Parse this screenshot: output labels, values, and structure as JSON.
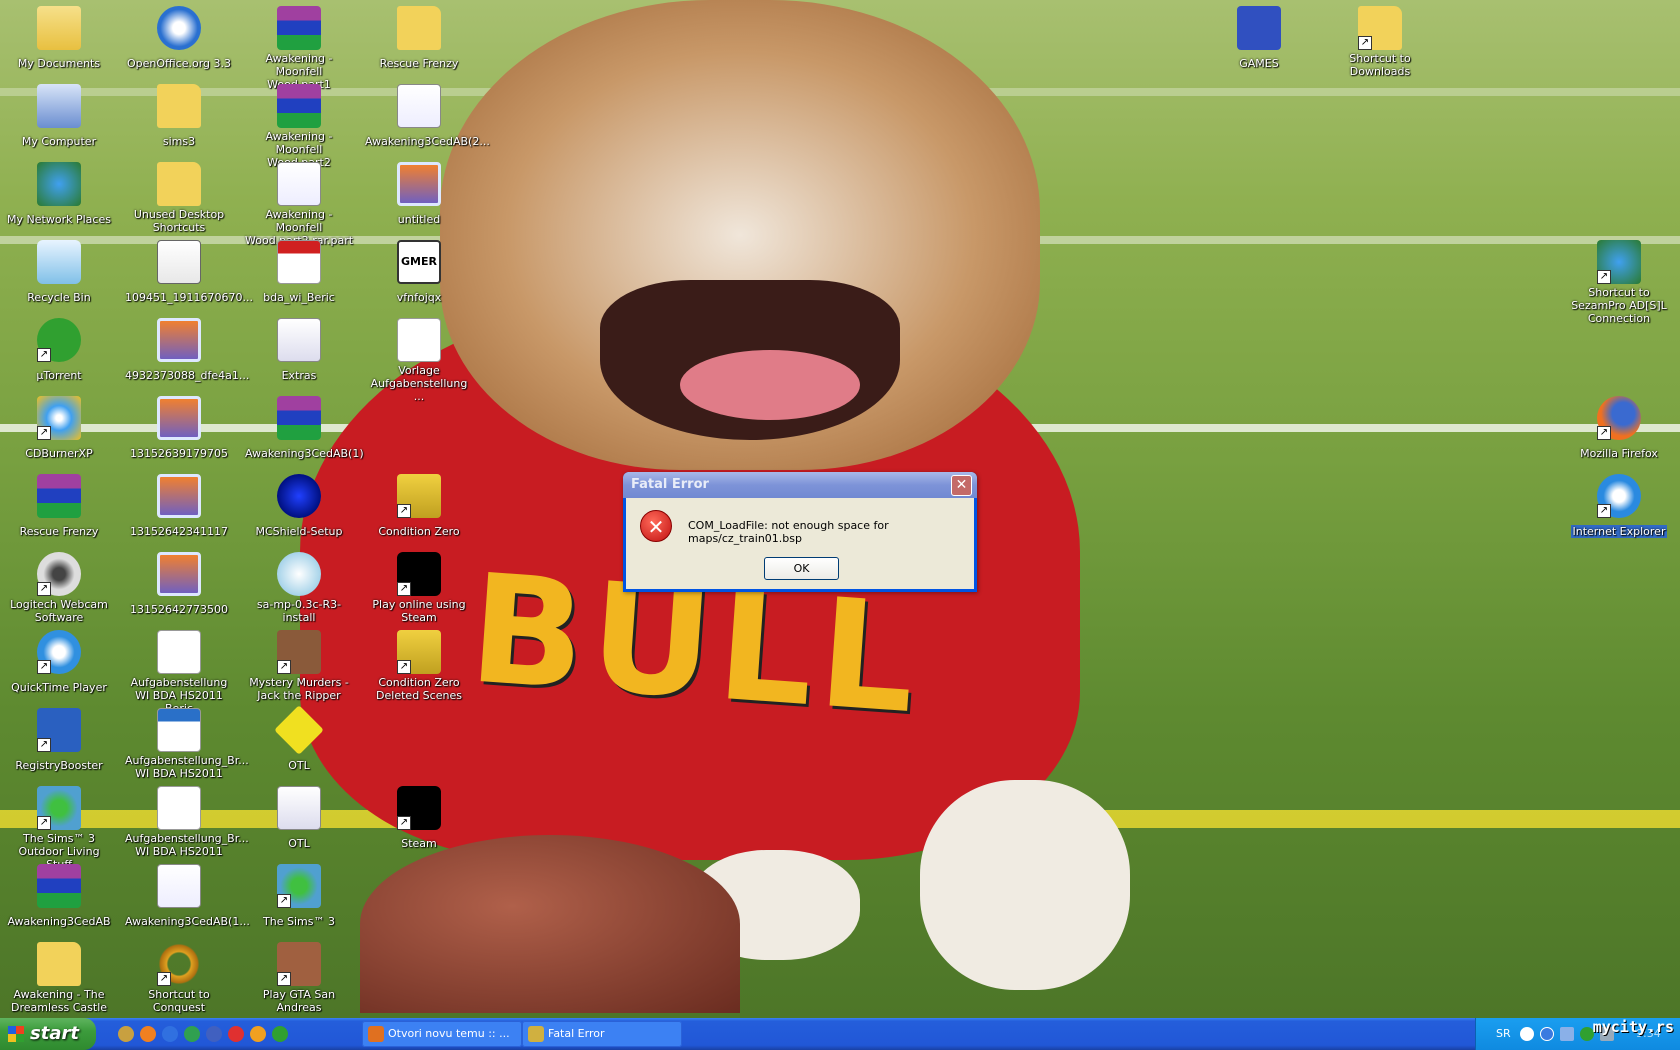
{
  "desktop": {
    "columns": [
      [
        {
          "label": "My Documents",
          "type": "folder-docs"
        },
        {
          "label": "My Computer",
          "type": "computer"
        },
        {
          "label": "My Network Places",
          "type": "network"
        },
        {
          "label": "Recycle Bin",
          "type": "recycle"
        },
        {
          "label": "µTorrent",
          "type": "utorrent",
          "shortcut": true
        },
        {
          "label": "CDBurnerXP",
          "type": "cd",
          "shortcut": true
        },
        {
          "label": "Rescue Frenzy",
          "type": "rar"
        },
        {
          "label": "Logitech Webcam Software",
          "type": "webcam",
          "shortcut": true
        },
        {
          "label": "QuickTime Player",
          "type": "quicktime",
          "shortcut": true
        },
        {
          "label": "RegistryBooster",
          "type": "booster",
          "shortcut": true
        },
        {
          "label": "The Sims™ 3 Outdoor Living Stuff",
          "type": "sims",
          "shortcut": true
        },
        {
          "label": "Awakening3CedAB",
          "type": "rar"
        },
        {
          "label": "Awakening - The Dreamless Castle",
          "type": "folder"
        }
      ],
      [
        {
          "label": "OpenOffice.org 3.3",
          "type": "openoffice"
        },
        {
          "label": "sims3",
          "type": "folder"
        },
        {
          "label": "Unused Desktop Shortcuts",
          "type": "folder"
        },
        {
          "label": "109451_1911670670...",
          "type": "help"
        },
        {
          "label": "4932373088_dfe4a1...",
          "type": "image"
        },
        {
          "label": "13152639179705",
          "type": "image"
        },
        {
          "label": "13152642341117",
          "type": "image"
        },
        {
          "label": "13152642773500",
          "type": "image"
        },
        {
          "label": "Aufgabenstellung WI BDA HS2011 Beric",
          "type": "doc"
        },
        {
          "label": "Aufgabenstellung_Br... WI BDA HS2011",
          "type": "odf"
        },
        {
          "label": "Aufgabenstellung_Br... WI BDA HS2011",
          "type": "doc"
        },
        {
          "label": "Awakening3CedAB(1...",
          "type": "app-file"
        },
        {
          "label": "Shortcut to Conquest",
          "type": "ring",
          "shortcut": true
        }
      ],
      [
        {
          "label": "Awakening - Moonfell Wood.part1",
          "type": "rar"
        },
        {
          "label": "Awakening - Moonfell Wood.part2",
          "type": "rar"
        },
        {
          "label": "Awakening - Moonfell Wood.part2.rar.part",
          "type": "app-file"
        },
        {
          "label": "bda_wi_Beric",
          "type": "pdf"
        },
        {
          "label": "Extras",
          "type": "notepad"
        },
        {
          "label": "Awakening3CedAB(1)",
          "type": "rar"
        },
        {
          "label": "MCShield-Setup",
          "type": "mcshield"
        },
        {
          "label": "sa-mp-0.3c-R3-install",
          "type": "installer"
        },
        {
          "label": "Mystery Murders - Jack the Ripper",
          "type": "game-face",
          "shortcut": true
        },
        {
          "label": "OTL",
          "type": "otl"
        },
        {
          "label": "OTL",
          "type": "notepad"
        },
        {
          "label": "The Sims™ 3",
          "type": "sims",
          "shortcut": true
        },
        {
          "label": "Play GTA San Andreas",
          "type": "gta",
          "shortcut": true
        }
      ],
      [
        {
          "label": "Rescue Frenzy",
          "type": "folder"
        },
        {
          "label": "Awakening3CedAB(2...",
          "type": "app-file"
        },
        {
          "label": "untitled",
          "type": "image"
        },
        {
          "label": "vfnfojqx",
          "type": "gmer",
          "text": "GMER"
        },
        {
          "label": "Vorlage Aufgabenstellung ...",
          "type": "doc"
        },
        null,
        {
          "label": "Condition Zero",
          "type": "cs",
          "shortcut": true
        },
        {
          "label": "Play online using Steam",
          "type": "steam",
          "shortcut": true
        },
        {
          "label": "Condition Zero Deleted Scenes",
          "type": "cs",
          "shortcut": true
        },
        null,
        {
          "label": "Steam",
          "type": "steam",
          "shortcut": true
        }
      ]
    ],
    "right_icons": [
      {
        "label": "GAMES",
        "type": "games",
        "col": "games"
      },
      {
        "label": "Shortcut to Downloads",
        "type": "folder",
        "col": "downloads",
        "shortcut": true
      },
      {
        "label": "Shortcut to SezamPro AD[S]L Connection",
        "type": "network",
        "col": "right",
        "row": 3,
        "shortcut": true
      },
      {
        "label": "Mozilla Firefox",
        "type": "firefox",
        "col": "right",
        "row": 5,
        "shortcut": true
      },
      {
        "label": "Internet Explorer",
        "type": "ie",
        "col": "right",
        "row": 6,
        "shortcut": true,
        "selected": true
      }
    ],
    "wallpaper_text": "BULL"
  },
  "dialog": {
    "title": "Fatal Error",
    "close": "✕",
    "icon": "error-icon",
    "message": "COM_LoadFile: not enough space for maps/cz_train01.bsp",
    "ok_label": "OK"
  },
  "taskbar": {
    "start_label": "start",
    "quick_launch": [
      "#c8a040",
      "#f08020",
      "#3070e0",
      "#30a050",
      "#4060c0",
      "#e03030",
      "#f0a020",
      "#30a030"
    ],
    "tasks": [
      {
        "label": "Otvori novu temu :: ...",
        "icon": "firefox-icon"
      },
      {
        "label": "Fatal Error",
        "icon": "counter-strike-icon"
      }
    ],
    "tray": {
      "lang": "SR",
      "time": "9:34",
      "watermark": "mycity.rs"
    }
  },
  "colors": {
    "taskbar": "#245edb",
    "start": "#3c9c3c",
    "dialog_title": "#7d93d8",
    "selection": "#316ac5"
  }
}
